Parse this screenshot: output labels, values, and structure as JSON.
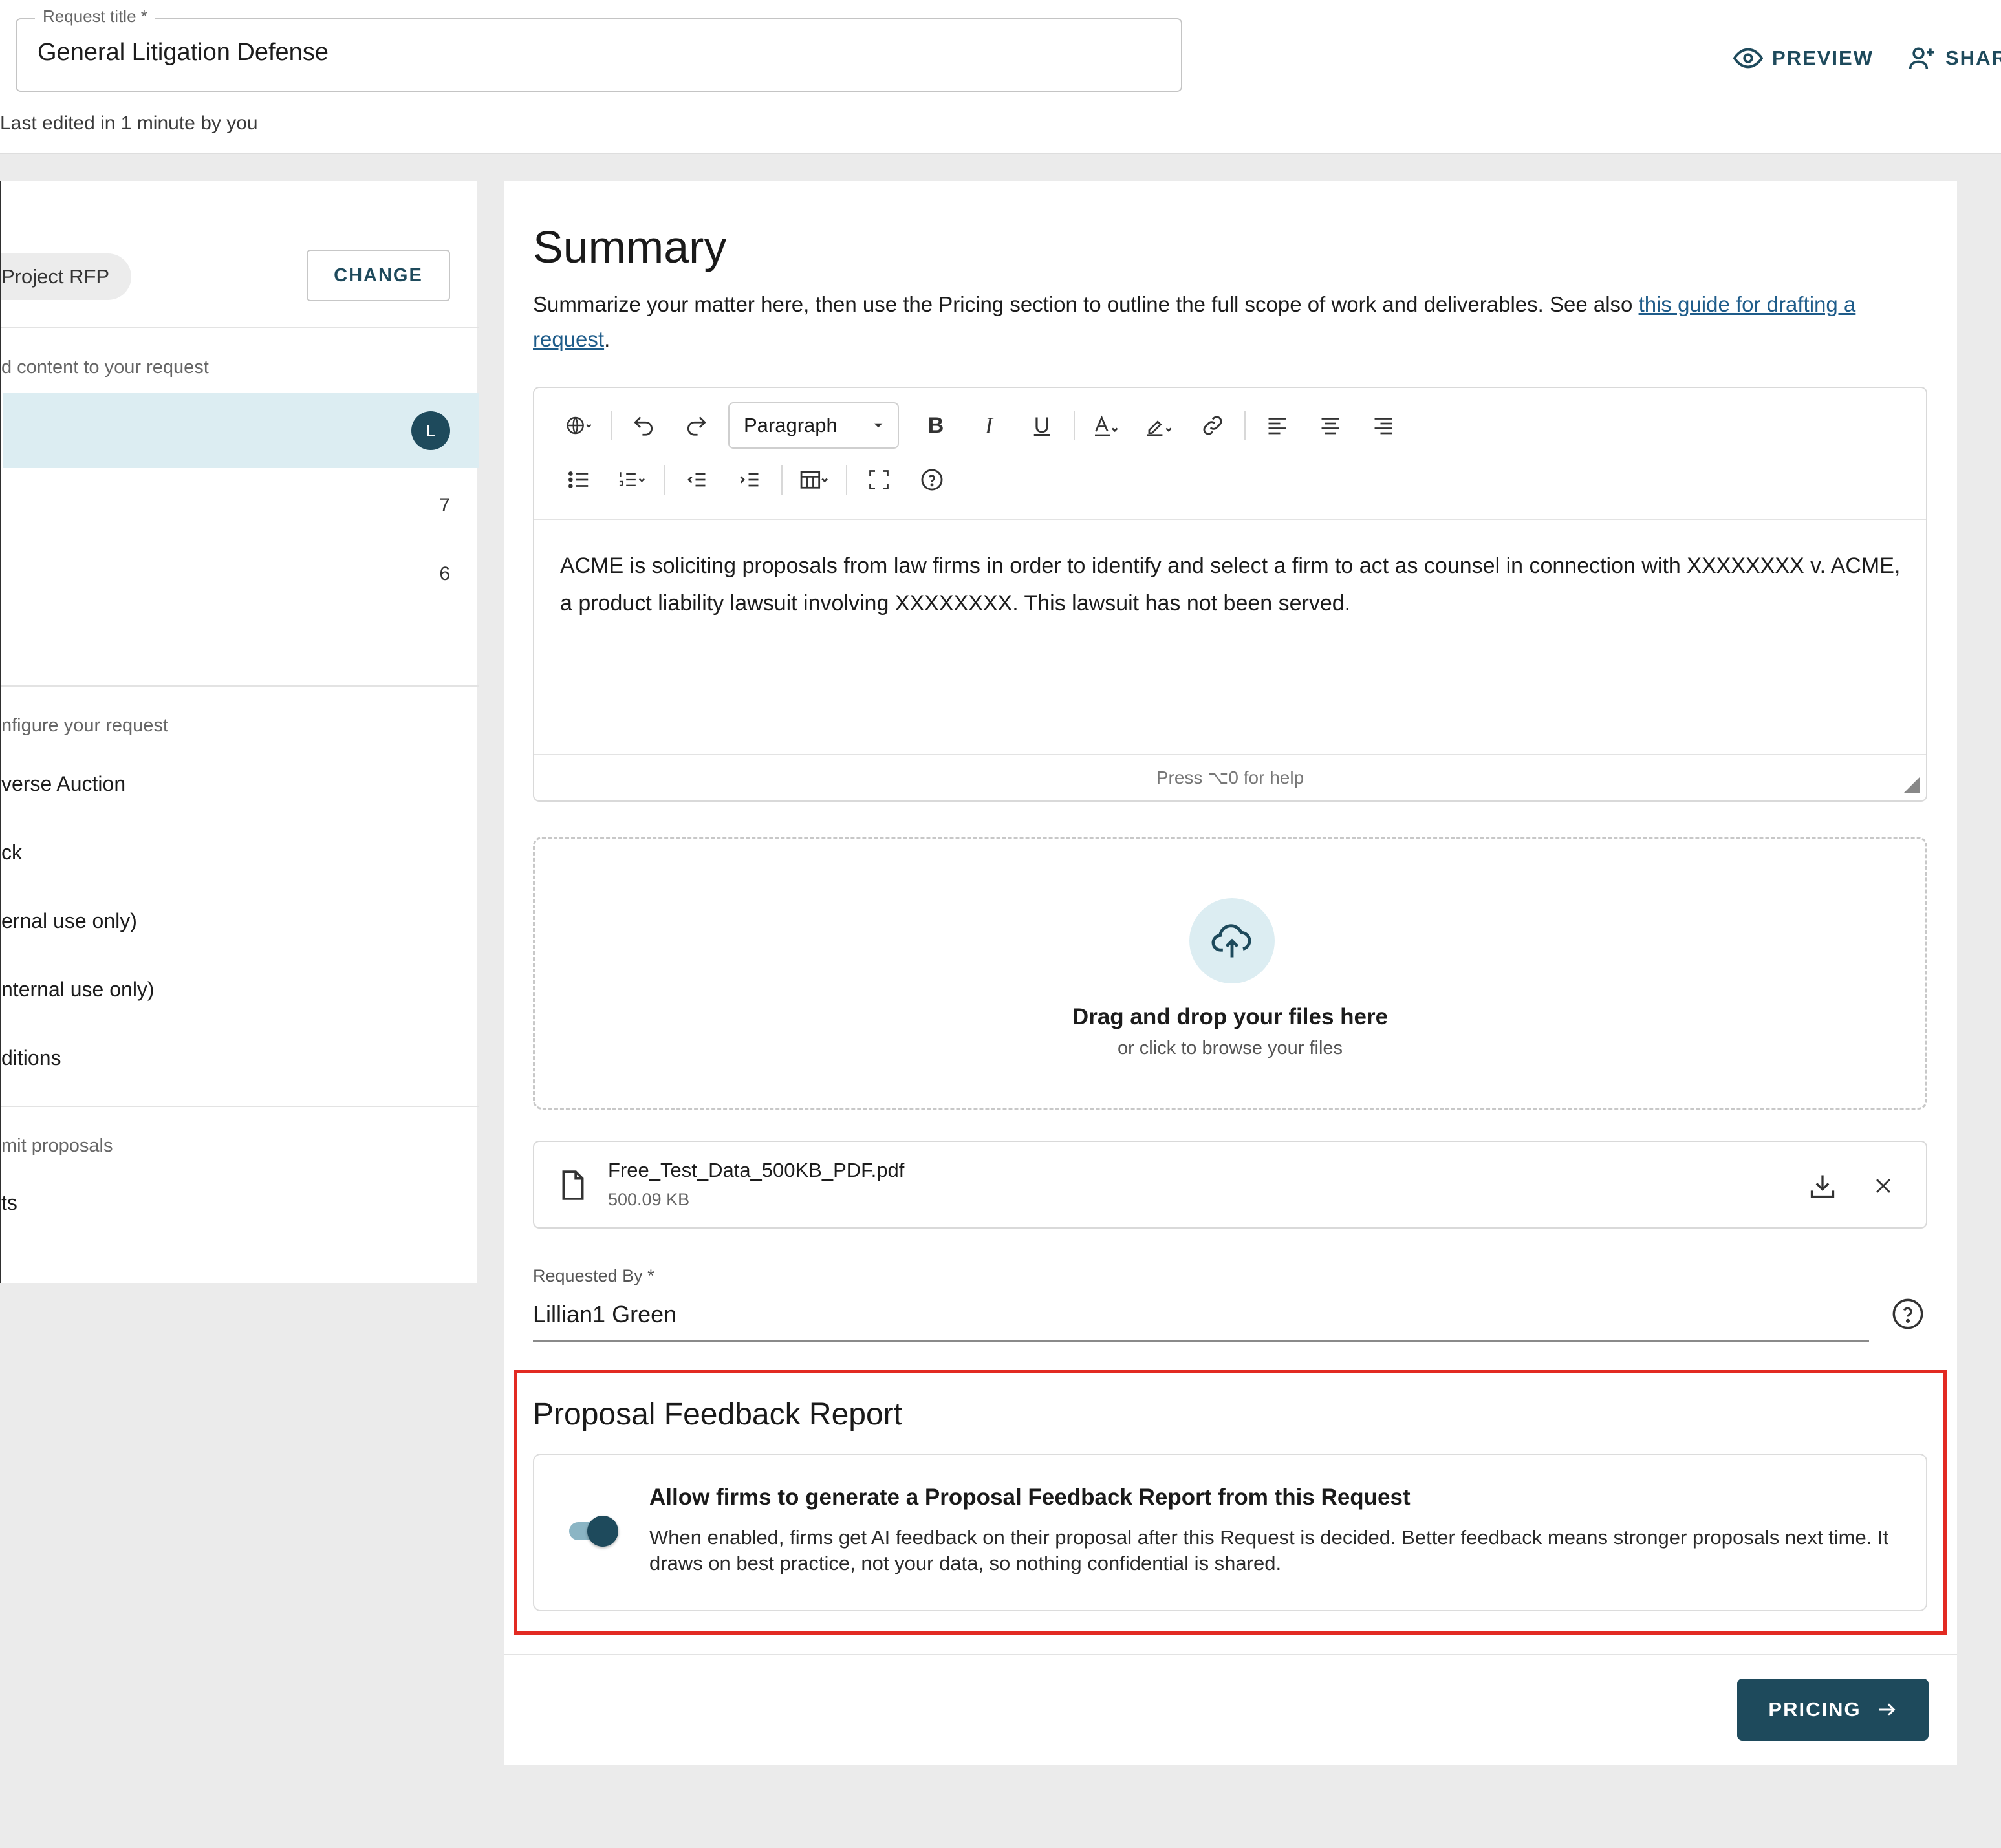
{
  "header": {
    "title_label": "Request title *",
    "title_value": "General Litigation Defense",
    "last_edited": "Last edited in 1 minute by you",
    "preview_label": "PREVIEW",
    "share_label": "SHARE"
  },
  "sidebar": {
    "template_chip": "Project RFP",
    "change_label": "CHANGE",
    "content_section_label": "d content to your request",
    "content_items": [
      {
        "badge": "L"
      },
      {
        "count": "7"
      },
      {
        "count": "6"
      }
    ],
    "configure_section_label": "nfigure your request",
    "configure_items": [
      "verse Auction",
      "ck",
      "ernal use only)",
      "nternal use only)",
      "ditions"
    ],
    "submit_section_label": "mit proposals",
    "submit_items": [
      "ts"
    ]
  },
  "summary": {
    "title": "Summary",
    "desc_text": "Summarize your matter here, then use the Pricing section to outline the full scope of work and deliverables. See also ",
    "desc_link": "this guide for drafting a request",
    "desc_end": "."
  },
  "editor": {
    "paragraph_label": "Paragraph",
    "body_text": "ACME is soliciting proposals from law firms in order to identify and select a firm to act as counsel in connection with XXXXXXXX v. ACME, a product liability lawsuit involving XXXXXXXX. This lawsuit has not been served.",
    "footer_hint": "Press ⌥0 for help"
  },
  "dropzone": {
    "title": "Drag and drop your files here",
    "subtitle": "or click to browse your files"
  },
  "file": {
    "name": "Free_Test_Data_500KB_PDF.pdf",
    "size": "500.09 KB"
  },
  "requested_by": {
    "label": "Requested By *",
    "value": "Lillian1 Green"
  },
  "feedback": {
    "title": "Proposal Feedback Report",
    "heading": "Allow firms to generate a Proposal Feedback Report from this Request",
    "description": "When enabled, firms get AI feedback on their proposal after this Request is decided. Better feedback means stronger proposals next time. It draws on best practice, not your data, so nothing confidential is shared.",
    "toggle_on": true
  },
  "footer": {
    "next_label": "PRICING"
  },
  "colors": {
    "primary": "#1e4a5c",
    "highlight_border": "#e22a22",
    "active_row": "#dcedf2"
  }
}
